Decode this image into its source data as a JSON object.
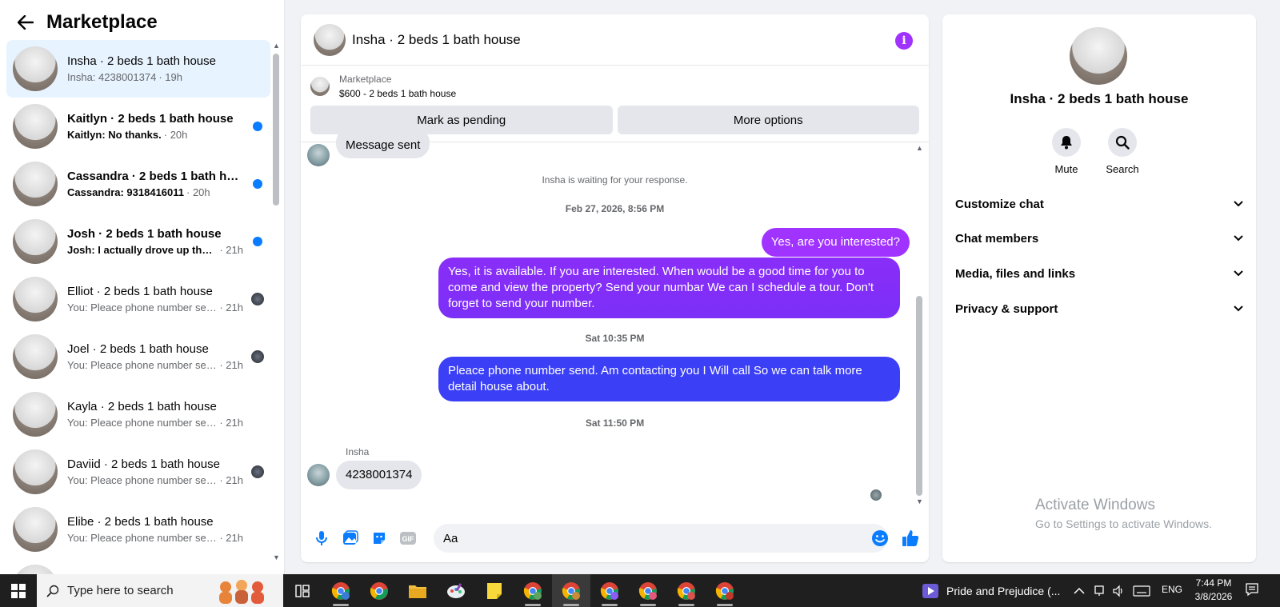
{
  "left": {
    "title": "Marketplace",
    "conversations": [
      {
        "name": "Insha · 2 beds 1 bath house",
        "preview": "Insha: 4238001374",
        "time": "· 19h"
      },
      {
        "name": "Kaitlyn · 2 beds 1 bath house",
        "preview": "Kaitlyn: No thanks.",
        "time": "· 20h"
      },
      {
        "name": "Cassandra · 2 beds 1 bath house",
        "preview": "Cassandra: 9318416011",
        "time": "· 20h"
      },
      {
        "name": "Josh · 2 beds 1 bath house",
        "preview": "Josh: I actually drove up there ...",
        "time": "· 21h"
      },
      {
        "name": "Elliot · 2 beds 1 bath house",
        "preview": "You: Pleace phone number sen...",
        "time": "· 21h"
      },
      {
        "name": "Joel · 2 beds 1 bath house",
        "preview": "You: Pleace phone number sen...",
        "time": "· 21h"
      },
      {
        "name": "Kayla · 2 beds 1 bath house",
        "preview": "You: Pleace phone number send. ...",
        "time": "· 21h"
      },
      {
        "name": "Daviid · 2 beds 1 bath house",
        "preview": "You: Pleace phone number sen...",
        "time": "· 21h"
      },
      {
        "name": "Elibe · 2 beds 1 bath house",
        "preview": "You: Pleace phone number send. ...",
        "time": "· 21h"
      }
    ]
  },
  "chat": {
    "title": "Insha · 2 beds 1 bath house",
    "listing_source": "Marketplace",
    "listing_price": "$600 - 2 beds 1 bath house",
    "mark_pending": "Mark as pending",
    "more_options": "More options",
    "partial_msg": "Message sent",
    "waiting": "Insha is waiting for your response.",
    "ts1": "Feb 27, 2026, 8:56 PM",
    "msg1": "Yes, are you interested?",
    "msg2": "Yes, it is available. If you are interested.   When would be a good time for you to come and view the property? Send your numbar We can I schedule a tour.  Don't forget to send your number.",
    "ts2": "Sat 10:35 PM",
    "msg3": "Pleace phone number send. Am contacting you I Will call So we can talk more detail house about.",
    "ts3": "Sat 11:50 PM",
    "sender": "Insha",
    "msg4": "4238001374",
    "input_value": "Aa",
    "colors": {
      "purple": "#a033ff",
      "violet": "#7b2ff7",
      "blue": "#3b3ff5",
      "accent": "#0a7cff"
    }
  },
  "right": {
    "name": "Insha · 2 beds 1 bath house",
    "mute": "Mute",
    "search": "Search",
    "sections": [
      "Customize chat",
      "Chat members",
      "Media, files and links",
      "Privacy & support"
    ],
    "watermark1": "Activate Windows",
    "watermark2": "Go to Settings to activate Windows."
  },
  "taskbar": {
    "search_placeholder": "Type here to search",
    "media_title": "Pride and Prejudice (...",
    "lang": "ENG",
    "time": "7:44 PM",
    "date": "3/8/2026"
  }
}
